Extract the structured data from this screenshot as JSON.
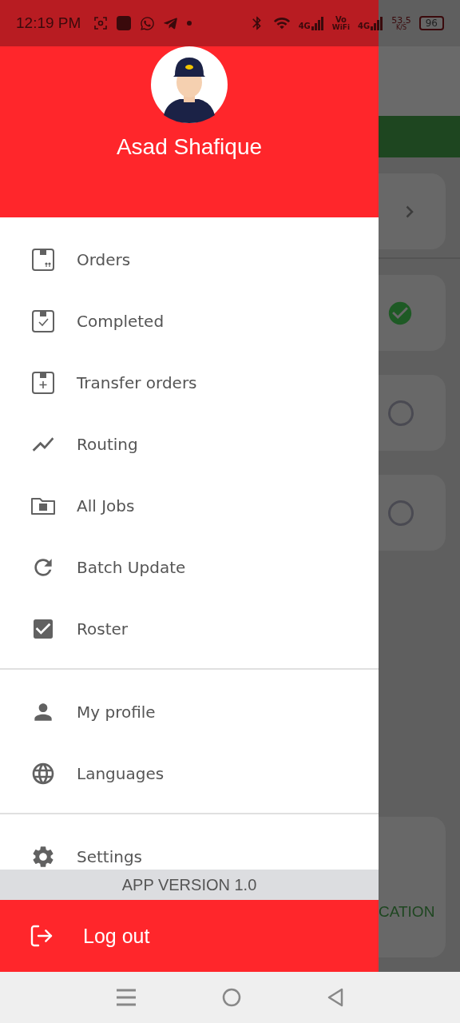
{
  "status_bar": {
    "time": "12:19 PM",
    "signals": [
      {
        "kind": "lte",
        "label": "4G"
      },
      {
        "kind": "volte",
        "label": "Vo",
        "sublabel": "WiFi"
      },
      {
        "kind": "lte",
        "label": "4G"
      }
    ],
    "speed": "53.5",
    "speed_unit": "K/S",
    "battery": "96"
  },
  "drawer": {
    "user_name": "Asad Shafique",
    "sections": [
      [
        {
          "kind": "orders",
          "label": "Orders"
        },
        {
          "kind": "completed",
          "label": "Completed"
        },
        {
          "kind": "transfer",
          "label": "Transfer orders"
        },
        {
          "kind": "routing",
          "label": "Routing"
        },
        {
          "kind": "jobs",
          "label": "All Jobs"
        },
        {
          "kind": "batch",
          "label": "Batch Update"
        },
        {
          "kind": "roster",
          "label": "Roster"
        }
      ],
      [
        {
          "kind": "profile",
          "label": "My profile"
        },
        {
          "kind": "languages",
          "label": "Languages"
        }
      ],
      [
        {
          "kind": "settings",
          "label": "Settings"
        }
      ]
    ],
    "version": "APP VERSION 1.0",
    "logout": "Log out"
  },
  "background": {
    "cards": [
      {
        "kind": "nav"
      },
      {
        "kind": "task",
        "checked": true
      },
      {
        "kind": "task",
        "checked": false
      },
      {
        "kind": "task",
        "checked": false
      },
      {
        "kind": "action",
        "label": "CATION"
      }
    ]
  }
}
